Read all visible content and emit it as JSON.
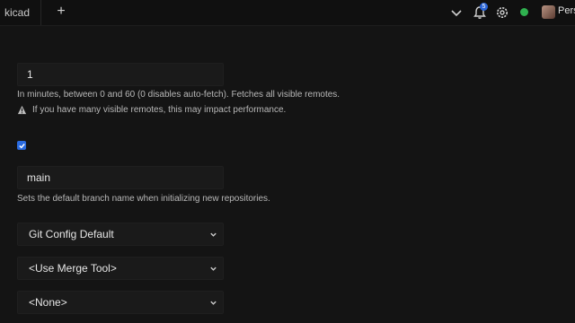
{
  "tab": {
    "label": "kicad",
    "new_tab": "+"
  },
  "notifications": {
    "count": "5"
  },
  "user": {
    "name": "Pers"
  },
  "colors": {
    "accent": "#2a6be0",
    "status": "#2fb14f"
  },
  "settings": {
    "autofetch_value": "1",
    "autofetch_help": "In minutes, between 0 and 60 (0 disables auto-fetch). Fetches all visible remotes.",
    "autofetch_warning": "If you have many visible remotes, this may impact performance.",
    "checkbox_checked": true,
    "default_branch_value": "main",
    "default_branch_help": "Sets the default branch name when initializing new repositories.",
    "select_1": "Git Config Default",
    "select_2": "<Use Merge Tool>",
    "select_3": "<None>"
  },
  "icons": [
    "chevron-down-icon",
    "bell-icon",
    "gear-icon",
    "warning-icon",
    "check-icon"
  ]
}
